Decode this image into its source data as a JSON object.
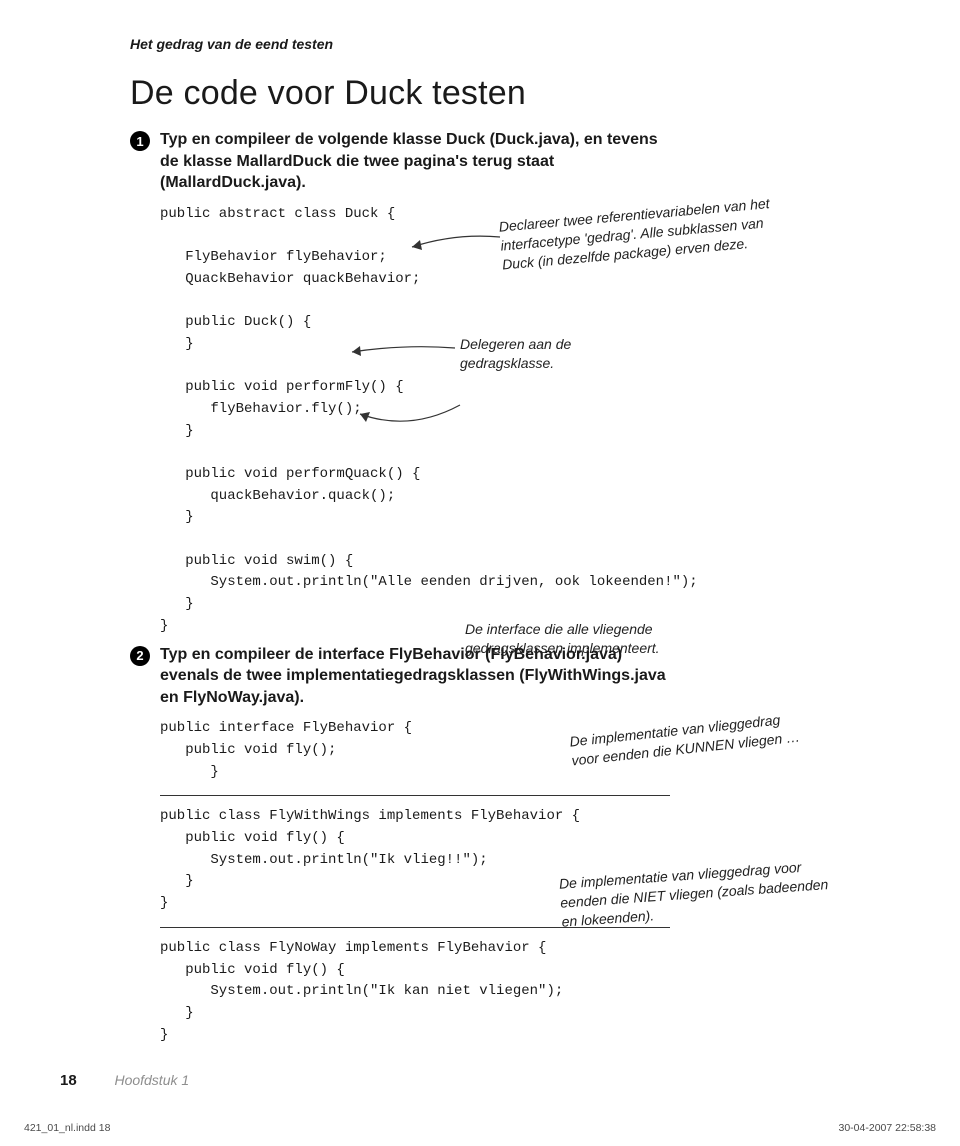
{
  "running_head": "Het gedrag van de eend testen",
  "big_title": "De code voor Duck testen",
  "steps": {
    "1": "Typ en compileer de volgende klasse Duck (Duck.java), en tevens de klasse MallardDuck die twee pagina's terug staat (MallardDuck.java).",
    "2": "Typ en compileer de interface FlyBehavior (FlyBehavior.java) evenals de twee implementatiegedragsklassen (FlyWithWings.java en FlyNoWay.java)."
  },
  "code": {
    "duck": "public abstract class Duck {\n\n   FlyBehavior flyBehavior;\n   QuackBehavior quackBehavior;\n\n   public Duck() {\n   }\n\n   public void performFly() {\n      flyBehavior.fly();\n   }\n\n   public void performQuack() {\n      quackBehavior.quack();\n   }\n\n   public void swim() {\n      System.out.println(\"Alle eenden drijven, ook lokeenden!\");\n   }\n}",
    "flybehavior": "public interface FlyBehavior {\n   public void fly();\n      }",
    "flywithwings": "public class FlyWithWings implements FlyBehavior {\n   public void fly() {\n      System.out.println(\"Ik vlieg!!\");\n   }\n}",
    "flynoway": "public class FlyNoWay implements FlyBehavior {\n   public void fly() {\n      System.out.println(\"Ik kan niet vliegen\");\n   }\n}"
  },
  "annotations": {
    "declare": "Declareer twee referentievariabelen van het interfacetype 'gedrag'. Alle subklassen van Duck (in dezelfde package) erven deze.",
    "delegate": "Delegeren aan de gedragsklasse.",
    "interface": "De interface die alle vliegende gedragsklassen implementeert.",
    "flywithwings": "De implementatie van vlieggedrag voor eenden die KUNNEN vliegen …",
    "flynoway": "De implementatie van vlieggedrag voor eenden die NIET vliegen (zoals badeenden en lokeenden)."
  },
  "page": {
    "number": "18",
    "chapter": "Hoofdstuk 1"
  },
  "footer": {
    "left": "421_01_nl.indd   18",
    "right": "30-04-2007   22:58:38"
  }
}
